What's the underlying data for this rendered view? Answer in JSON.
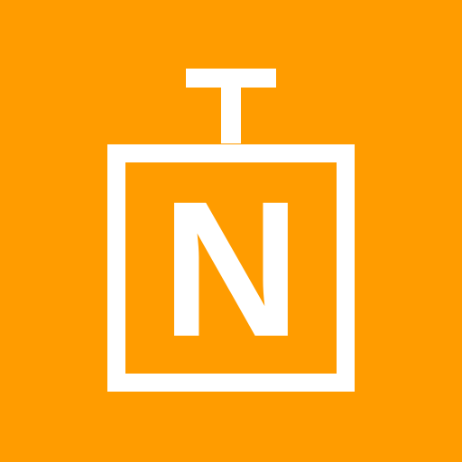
{
  "icon": {
    "name": "letter-n-box-icon",
    "letter": "N",
    "colors": {
      "background": "#FF9C00",
      "foreground": "#FFFFFF"
    }
  }
}
